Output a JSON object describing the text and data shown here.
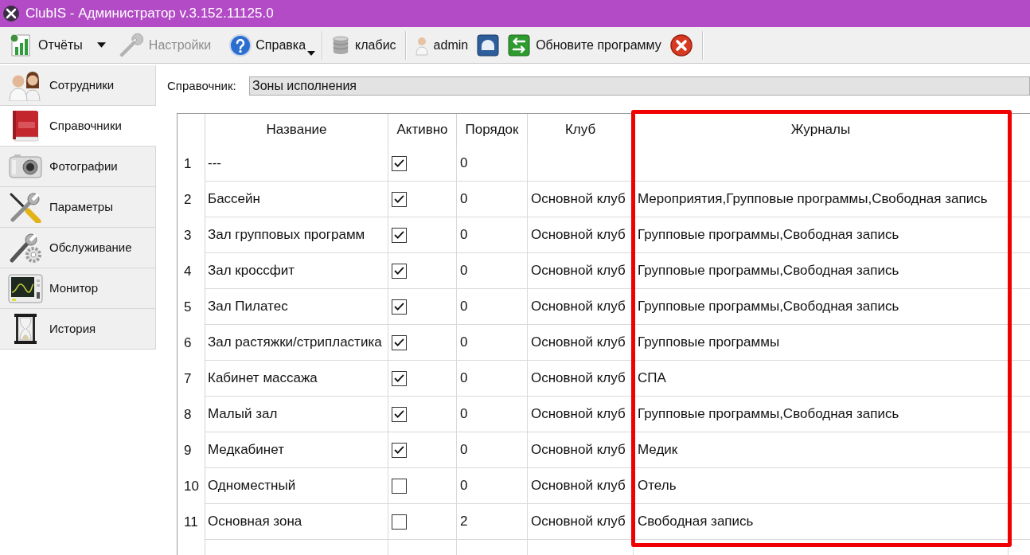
{
  "window": {
    "title": "ClubIS - Администратор v.3.152.11125.0"
  },
  "toolbar": {
    "groups": [
      {
        "items": [
          {
            "kind": "button",
            "label": "Отчёты",
            "disabled": false
          },
          {
            "kind": "dropdown",
            "disabled": false
          },
          {
            "kind": "button",
            "label": "Настройки",
            "disabled": true
          },
          {
            "kind": "menu",
            "label": "Справка",
            "disabled": false
          }
        ]
      },
      {
        "items": [
          {
            "kind": "button",
            "label": "клабис",
            "disabled": false
          }
        ]
      },
      {
        "items": [
          {
            "kind": "button",
            "label": "admin",
            "disabled": false
          },
          {
            "kind": "icon",
            "disabled": false
          },
          {
            "kind": "button",
            "label": "Обновите программу",
            "disabled": false
          },
          {
            "kind": "icon",
            "disabled": false
          }
        ]
      }
    ]
  },
  "sidebar": {
    "items": [
      {
        "label": "Сотрудники",
        "selected": false
      },
      {
        "label": "Справочники",
        "selected": true
      },
      {
        "label": "Фотографии",
        "selected": false
      },
      {
        "label": "Параметры",
        "selected": false
      },
      {
        "label": "Обслуживание",
        "selected": false
      },
      {
        "label": "Монитор",
        "selected": false
      },
      {
        "label": "История",
        "selected": false
      }
    ]
  },
  "reference": {
    "label": "Справочник:",
    "value": "Зоны исполнения"
  },
  "table": {
    "columns": [
      {
        "label": "Название",
        "highlighted": false
      },
      {
        "label": "Активно",
        "highlighted": false
      },
      {
        "label": "Порядок",
        "highlighted": false
      },
      {
        "label": "Клуб",
        "highlighted": false
      },
      {
        "label": "Журналы",
        "highlighted": true
      }
    ],
    "rows": [
      {
        "number": "1",
        "name": "---",
        "active": true,
        "order": "0"
      },
      {
        "number": "2",
        "name": "Бассейн",
        "active": true,
        "order": "0",
        "club": "Основной клуб",
        "journals": "Мероприятия,Групповые программы,Свободная запись"
      },
      {
        "number": "3",
        "name": "Зал групповых программ",
        "active": true,
        "order": "0",
        "club": "Основной клуб",
        "journals": "Групповые программы,Свободная запись"
      },
      {
        "number": "4",
        "name": "Зал кроссфит",
        "active": true,
        "order": "0",
        "club": "Основной клуб",
        "journals": "Групповые программы,Свободная запись"
      },
      {
        "number": "5",
        "name": "Зал Пилатес",
        "active": true,
        "order": "0",
        "club": "Основной клуб",
        "journals": "Групповые программы,Свободная запись"
      },
      {
        "number": "6",
        "name": "Зал растяжки/стрипластика",
        "active": true,
        "order": "0",
        "club": "Основной клуб",
        "journals": "Групповые программы"
      },
      {
        "number": "7",
        "name": "Кабинет массажа",
        "active": true,
        "order": "0",
        "club": "Основной клуб",
        "journals": "СПА"
      },
      {
        "number": "8",
        "name": "Малый зал",
        "active": true,
        "order": "0",
        "club": "Основной клуб",
        "journals": "Групповые программы,Свободная запись"
      },
      {
        "number": "9",
        "name": "Медкабинет",
        "active": true,
        "order": "0",
        "club": "Основной клуб",
        "journals": "Медик"
      },
      {
        "number": "10",
        "name": "Одноместный",
        "active": false,
        "order": "0",
        "club": "Основной клуб",
        "journals": "Отель"
      },
      {
        "number": "11",
        "name": "Основная зона",
        "active": false,
        "order": "2",
        "club": "Основной клуб",
        "journals": "Свободная запись"
      }
    ]
  }
}
